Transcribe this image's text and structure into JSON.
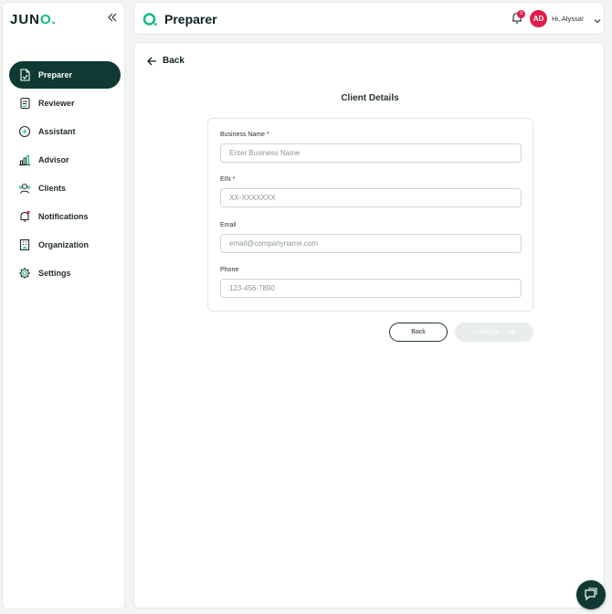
{
  "brand": {
    "logo_text": "JUN",
    "logo_dot": "O.",
    "accent": "#10b981",
    "dark": "#0f3a33",
    "badge_color": "#e11d48"
  },
  "sidebar": {
    "collapse_icon": "double-chevron-left-icon",
    "items": [
      {
        "label": "Preparer",
        "icon": "document-icon",
        "active": true
      },
      {
        "label": "Reviewer",
        "icon": "review-icon",
        "active": false
      },
      {
        "label": "Assistant",
        "icon": "assistant-icon",
        "active": false
      },
      {
        "label": "Advisor",
        "icon": "chart-icon",
        "active": false
      },
      {
        "label": "Clients",
        "icon": "clients-icon",
        "active": false
      },
      {
        "label": "Notifications",
        "icon": "bell-icon",
        "active": false
      },
      {
        "label": "Organization",
        "icon": "building-icon",
        "active": false
      },
      {
        "label": "Settings",
        "icon": "gear-icon",
        "active": false
      }
    ]
  },
  "header": {
    "title": "Preparer",
    "notifications_count": "9",
    "avatar_initials": "AD",
    "greeting": "Hi, Alyssa!"
  },
  "main": {
    "back_label": "Back",
    "title": "Client Details",
    "fields": [
      {
        "label": "Business Name *",
        "placeholder": "Enter Business Name",
        "value": ""
      },
      {
        "label": "EIN *",
        "placeholder": "XX-XXXXXXX",
        "value": ""
      },
      {
        "label": "Email",
        "placeholder": "email@companyname.com",
        "value": ""
      },
      {
        "label": "Phone",
        "placeholder": "123-456-7890",
        "value": ""
      }
    ],
    "back_button": "Back",
    "continue_button": "Continue"
  }
}
